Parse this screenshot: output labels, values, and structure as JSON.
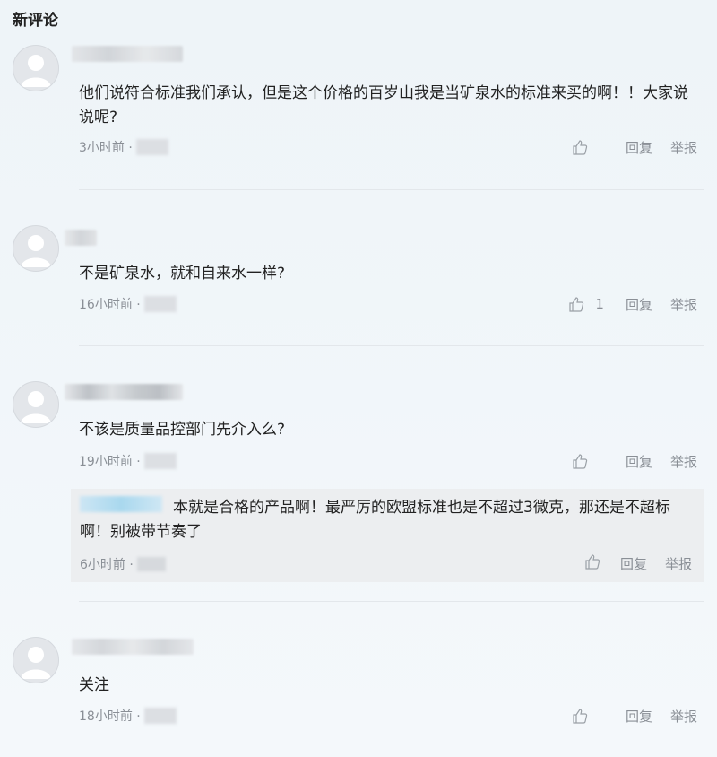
{
  "section_title": "新评论",
  "labels": {
    "reply": "回复",
    "report": "举报"
  },
  "comments": [
    {
      "text": "他们说符合标准我们承认，但是这个价格的百岁山我是当矿泉水的标准来买的啊！！大家说说呢?",
      "time": "3小时前 · ",
      "likes": ""
    },
    {
      "text": "不是矿泉水，就和自来水一样?",
      "time": "16小时前 · ",
      "likes": "1"
    },
    {
      "text": "不该是质量品控部门先介入么?",
      "time": "19小时前 · ",
      "likes": "",
      "reply": {
        "text": "本就是合格的产品啊！最严厉的欧盟标准也是不超过3微克，那还是不超标啊！别被带节奏了",
        "time": "6小时前 · "
      }
    },
    {
      "text": "关注",
      "time": "18小时前 · ",
      "likes": ""
    }
  ],
  "icons": {
    "avatar": "default-avatar-icon",
    "like": "thumbs-up-icon"
  }
}
